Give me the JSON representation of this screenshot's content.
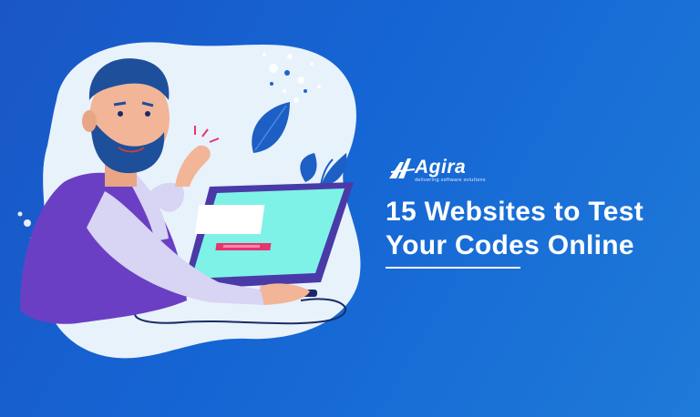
{
  "brand": {
    "name": "Agira",
    "tagline": "delivering software solutions"
  },
  "headline": {
    "line1": "15 Websites to Test",
    "line2": "Your Codes Online"
  },
  "colors": {
    "background": "#1565d4",
    "blob": "#e8f2fb",
    "screen": "#7ef2e6",
    "shirt": "#d7d4f4",
    "vest": "#6b3fc4",
    "accent_pink": "#e8336d",
    "leaf": "#1d5fc4"
  },
  "icons": [
    "agira-logo-icon",
    "developer-illustration",
    "monitor-icon",
    "leaf-icon"
  ]
}
